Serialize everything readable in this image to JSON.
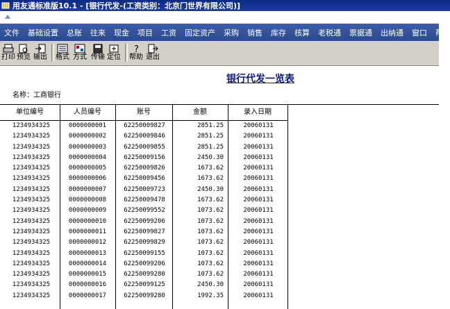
{
  "window": {
    "title": "用友通标准版10.1 - [银行代发-(工资类别：北京门世界有限公司)]"
  },
  "menu": {
    "items": [
      "文件",
      "基础设置",
      "总账",
      "往来",
      "现金",
      "项目",
      "工资",
      "固定资产",
      "采购",
      "销售",
      "库存",
      "核算",
      "老税通",
      "票据通",
      "出纳通",
      "窗口",
      "帮助"
    ]
  },
  "toolbar": {
    "buttons": [
      {
        "label": "打印",
        "icon": "printer-icon"
      },
      {
        "label": "预览",
        "icon": "preview-icon"
      },
      {
        "label": "输出",
        "icon": "export-icon"
      },
      {
        "label": "格式",
        "icon": "format-icon"
      },
      {
        "label": "方式",
        "icon": "mode-icon"
      },
      {
        "label": "传输",
        "icon": "disk-icon"
      },
      {
        "label": "定位",
        "icon": "locate-icon"
      },
      {
        "label": "帮助",
        "icon": "help-icon"
      },
      {
        "label": "退出",
        "icon": "exit-icon"
      }
    ]
  },
  "report": {
    "title": "银行代发一览表",
    "name_label": "名称：工商银行",
    "columns": [
      "单位编号",
      "人员编号",
      "账号",
      "金额",
      "录入日期"
    ],
    "rows": [
      [
        "1234934325",
        "0000000001",
        "62250009827",
        "2851.25",
        "20060131"
      ],
      [
        "1234934325",
        "0000000002",
        "62250009846",
        "2851.25",
        "20060131"
      ],
      [
        "1234934325",
        "0000000003",
        "62250009855",
        "2851.25",
        "20060131"
      ],
      [
        "1234934325",
        "0000000004",
        "62250009156",
        "2450.30",
        "20060131"
      ],
      [
        "1234934325",
        "0000000005",
        "62250009826",
        "1673.62",
        "20060131"
      ],
      [
        "1234934325",
        "0000000006",
        "62250009456",
        "1673.62",
        "20060131"
      ],
      [
        "1234934325",
        "0000000007",
        "62250009723",
        "2450.30",
        "20060131"
      ],
      [
        "1234934325",
        "0000000008",
        "62250009478",
        "1673.62",
        "20060131"
      ],
      [
        "1234934325",
        "0000000009",
        "62250099552",
        "1073.62",
        "20060131"
      ],
      [
        "1234934325",
        "0000000010",
        "62250099206",
        "1073.62",
        "20060131"
      ],
      [
        "1234934325",
        "0000000011",
        "62250099827",
        "1073.62",
        "20060131"
      ],
      [
        "1234934325",
        "0000000012",
        "62250099829",
        "1073.62",
        "20060131"
      ],
      [
        "1234934325",
        "0000000013",
        "62250099155",
        "1073.62",
        "20060131"
      ],
      [
        "1234934325",
        "0000000014",
        "62250099206",
        "1073.62",
        "20060131"
      ],
      [
        "1234934325",
        "0000000015",
        "62250099280",
        "1073.62",
        "20060131"
      ],
      [
        "1234934325",
        "0000000016",
        "62250099125",
        "2450.30",
        "20060131"
      ],
      [
        "1234934325",
        "0000000017",
        "62250099280",
        "1992.35",
        "20060131"
      ]
    ]
  }
}
